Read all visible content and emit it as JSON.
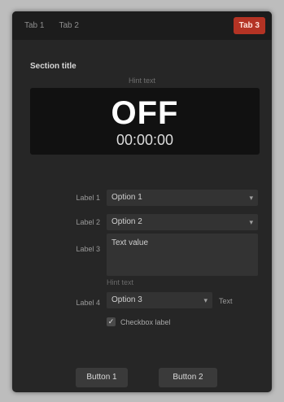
{
  "tabs": [
    {
      "label": "Tab 1"
    },
    {
      "label": "Tab 2"
    },
    {
      "label": "Tab 3"
    }
  ],
  "section": {
    "title": "Section title",
    "hint": "Hint text"
  },
  "status": {
    "state": "OFF",
    "time": "00:00:00"
  },
  "fields": {
    "field1": {
      "label": "Label 1",
      "value": "Option 1"
    },
    "field2": {
      "label": "Label 2",
      "value": "Option 2"
    },
    "field3": {
      "label": "Label 3",
      "value": "Text value",
      "hint": "Hint text"
    },
    "field4": {
      "label": "Label 4",
      "value": "Option 3",
      "aux": "Text"
    }
  },
  "checkbox": {
    "label": "Checkbox label",
    "checked": true
  },
  "buttons": {
    "left": "Button 1",
    "right": "Button 2"
  },
  "colors": {
    "record": "#b43324",
    "panel": "#262626"
  }
}
